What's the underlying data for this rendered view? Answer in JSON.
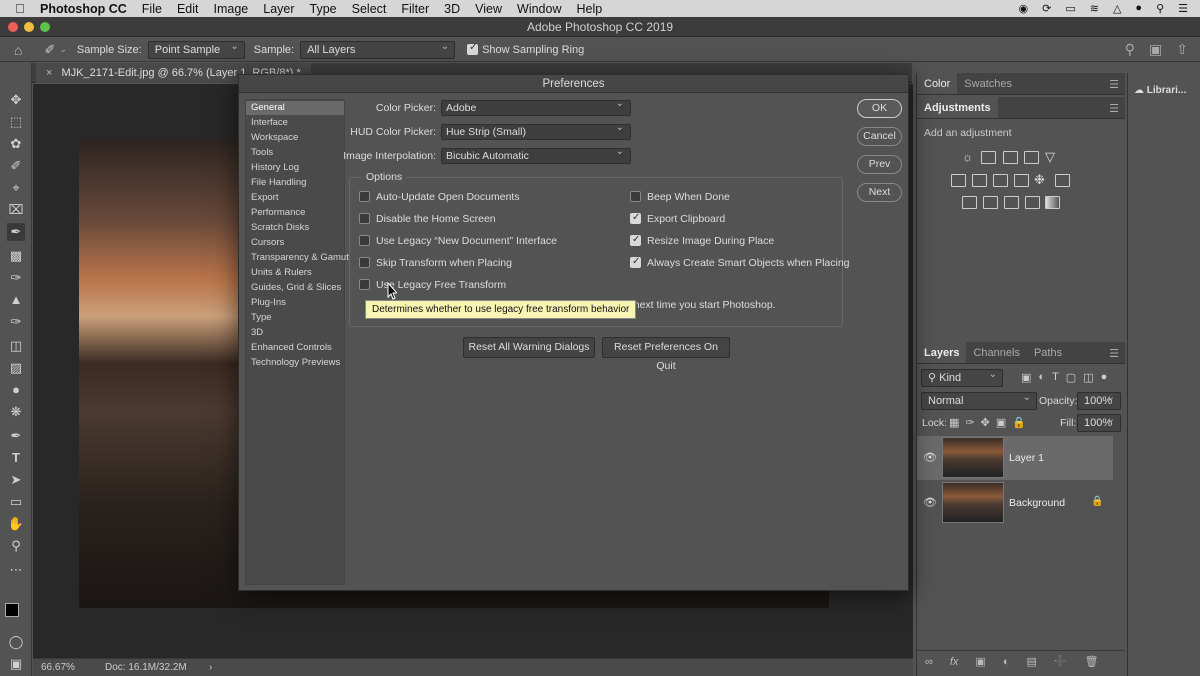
{
  "menubar": {
    "app_name": "Photoshop CC",
    "items": [
      "File",
      "Edit",
      "Image",
      "Layer",
      "Type",
      "Select",
      "Filter",
      "3D",
      "View",
      "Window",
      "Help"
    ]
  },
  "window": {
    "title": "Adobe Photoshop CC 2019"
  },
  "options_bar": {
    "sample_size_label": "Sample Size:",
    "sample_size_value": "Point Sample",
    "sample_label": "Sample:",
    "sample_value": "All Layers",
    "sampling_ring_label": "Show Sampling Ring",
    "sampling_ring_checked": true
  },
  "document_tab": {
    "close": "×",
    "label": "MJK_2171-Edit.jpg @ 66.7% (Layer 1, RGB/8*) *"
  },
  "status_bar": {
    "zoom": "66.67%",
    "doc": "Doc: 16.1M/32.2M",
    "arrow": "›"
  },
  "color_panel": {
    "tabs": [
      "Color",
      "Swatches"
    ]
  },
  "adjustments_panel": {
    "tab": "Adjustments",
    "hint": "Add an adjustment"
  },
  "libraries": {
    "label": "Librari..."
  },
  "layers_panel": {
    "tabs": [
      "Layers",
      "Channels",
      "Paths"
    ],
    "filter": "Kind",
    "blend_mode": "Normal",
    "opacity_label": "Opacity:",
    "opacity_value": "100%",
    "lock_label": "Lock:",
    "fill_label": "Fill:",
    "fill_value": "100%",
    "layers": [
      {
        "name": "Layer 1",
        "selected": true
      },
      {
        "name": "Background",
        "locked": true
      }
    ]
  },
  "preferences": {
    "title": "Preferences",
    "nav": [
      "General",
      "Interface",
      "Workspace",
      "Tools",
      "History Log",
      "File Handling",
      "Export",
      "Performance",
      "Scratch Disks",
      "Cursors",
      "Transparency & Gamut",
      "Units & Rulers",
      "Guides, Grid & Slices",
      "Plug-Ins",
      "Type",
      "3D",
      "Enhanced Controls",
      "Technology Previews"
    ],
    "selected_nav": "General",
    "fields": [
      {
        "label": "Color Picker:",
        "value": "Adobe"
      },
      {
        "label": "HUD Color Picker:",
        "value": "Hue Strip (Small)"
      },
      {
        "label": "Image Interpolation:",
        "value": "Bicubic Automatic"
      }
    ],
    "options_title": "Options",
    "options_left": [
      {
        "label": "Auto-Update Open Documents",
        "checked": false
      },
      {
        "label": "Disable the Home Screen",
        "checked": false
      },
      {
        "label": "Use Legacy “New Document” Interface",
        "checked": false
      },
      {
        "label": "Skip Transform when Placing",
        "checked": false
      },
      {
        "label": "Use Legacy Free Transform",
        "checked": false
      }
    ],
    "options_right": [
      {
        "label": "Beep When Done",
        "checked": false
      },
      {
        "label": "Export Clipboard",
        "checked": true
      },
      {
        "label": "Resize Image During Place",
        "checked": true
      },
      {
        "label": "Always Create Smart Objects when Placing",
        "checked": true
      }
    ],
    "restart_note_fragment": "e next time you start Photoshop.",
    "tooltip": "Determines whether to use legacy free transform behavior",
    "buttons": {
      "ok": "OK",
      "cancel": "Cancel",
      "prev": "Prev",
      "next": "Next"
    },
    "reset_warning": "Reset All Warning Dialogs",
    "reset_prefs": "Reset Preferences On Quit"
  }
}
